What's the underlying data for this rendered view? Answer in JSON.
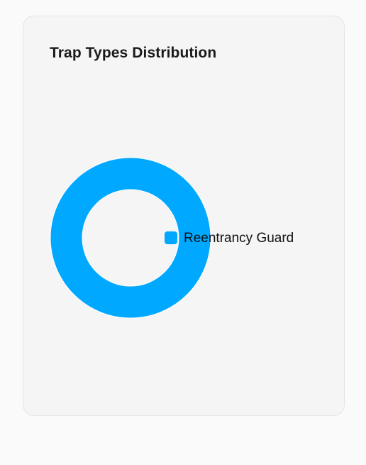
{
  "card": {
    "title": "Trap Types Distribution"
  },
  "chart_data": {
    "type": "pie",
    "variant": "donut",
    "title": "Trap Types Distribution",
    "categories": [
      "Reentrancy Guard"
    ],
    "values": [
      1
    ],
    "colors": [
      "#00a8ff"
    ],
    "legend": "right"
  }
}
